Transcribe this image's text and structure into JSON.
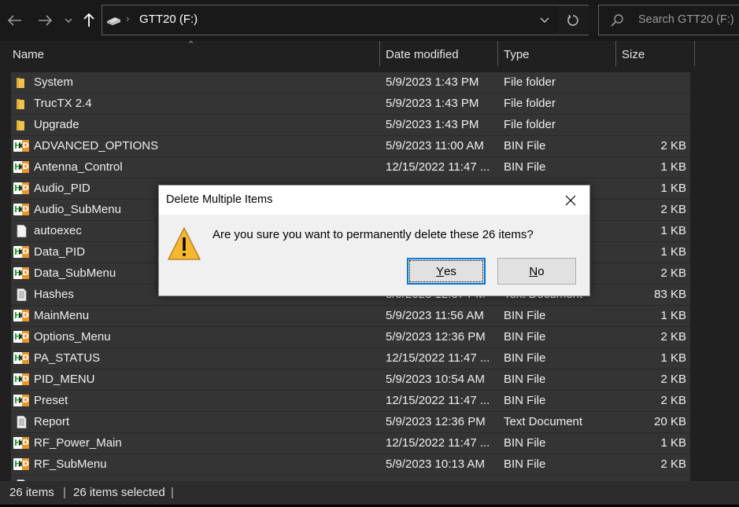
{
  "navbar": {
    "back_icon": "arrow-left-icon",
    "forward_icon": "arrow-right-icon",
    "recent_icon": "chevron-down-icon",
    "up_icon": "arrow-up-icon",
    "breadcrumb": "GTT20 (F:)",
    "search_placeholder": "Search GTT20 (F:)"
  },
  "columns": {
    "name": "Name",
    "date": "Date modified",
    "type": "Type",
    "size": "Size"
  },
  "files": [
    {
      "name": "System",
      "date": "5/9/2023 1:43 PM",
      "type": "File folder",
      "size": "",
      "icon": "folder"
    },
    {
      "name": "TrucTX 2.4",
      "date": "5/9/2023 1:43 PM",
      "type": "File folder",
      "size": "",
      "icon": "folder"
    },
    {
      "name": "Upgrade",
      "date": "5/9/2023 1:43 PM",
      "type": "File folder",
      "size": "",
      "icon": "folder"
    },
    {
      "name": "ADVANCED_OPTIONS",
      "date": "5/9/2023 11:00 AM",
      "type": "BIN File",
      "size": "2 KB",
      "icon": "hxd"
    },
    {
      "name": "Antenna_Control",
      "date": "12/15/2022 11:47 ...",
      "type": "BIN File",
      "size": "1 KB",
      "icon": "hxd"
    },
    {
      "name": "Audio_PID",
      "date": "",
      "type": "",
      "size": "1 KB",
      "icon": "hxd"
    },
    {
      "name": "Audio_SubMenu",
      "date": "",
      "type": "",
      "size": "2 KB",
      "icon": "hxd"
    },
    {
      "name": "autoexec",
      "date": "",
      "type": "",
      "size": "1 KB",
      "icon": "blank"
    },
    {
      "name": "Data_PID",
      "date": "",
      "type": "",
      "size": "1 KB",
      "icon": "hxd"
    },
    {
      "name": "Data_SubMenu",
      "date": "",
      "type": "",
      "size": "2 KB",
      "icon": "hxd"
    },
    {
      "name": "Hashes",
      "date": "5/9/2023 12:37 PM",
      "type": "Text Document",
      "size": "83 KB",
      "icon": "text"
    },
    {
      "name": "MainMenu",
      "date": "5/9/2023 11:56 AM",
      "type": "BIN File",
      "size": "1 KB",
      "icon": "hxd"
    },
    {
      "name": "Options_Menu",
      "date": "5/9/2023 12:36 PM",
      "type": "BIN File",
      "size": "2 KB",
      "icon": "hxd"
    },
    {
      "name": "PA_STATUS",
      "date": "12/15/2022 11:47 ...",
      "type": "BIN File",
      "size": "1 KB",
      "icon": "hxd"
    },
    {
      "name": "PID_MENU",
      "date": "5/9/2023 10:54 AM",
      "type": "BIN File",
      "size": "2 KB",
      "icon": "hxd"
    },
    {
      "name": "Preset",
      "date": "12/15/2022 11:47 ...",
      "type": "BIN File",
      "size": "2 KB",
      "icon": "hxd"
    },
    {
      "name": "Report",
      "date": "5/9/2023 12:36 PM",
      "type": "Text Document",
      "size": "20 KB",
      "icon": "text"
    },
    {
      "name": "RF_Power_Main",
      "date": "12/15/2022 11:47 ...",
      "type": "BIN File",
      "size": "1 KB",
      "icon": "hxd"
    },
    {
      "name": "RF_SubMenu",
      "date": "5/9/2023 10:13 AM",
      "type": "BIN File",
      "size": "2 KB",
      "icon": "hxd"
    },
    {
      "name": "",
      "date": "",
      "type": "",
      "size": "",
      "icon": "text"
    }
  ],
  "status": {
    "items": "26 items",
    "selected": "26 items selected",
    "sep": "|"
  },
  "dialog": {
    "title": "Delete Multiple Items",
    "message": "Are you sure you want to permanently delete these 26 items?",
    "yes_accel": "Y",
    "yes_rest": "es",
    "no_accel": "N",
    "no_rest": "o"
  },
  "colors": {
    "accent": "#0078d7",
    "folder": "#f1c14d",
    "warning": "#f7b731"
  }
}
